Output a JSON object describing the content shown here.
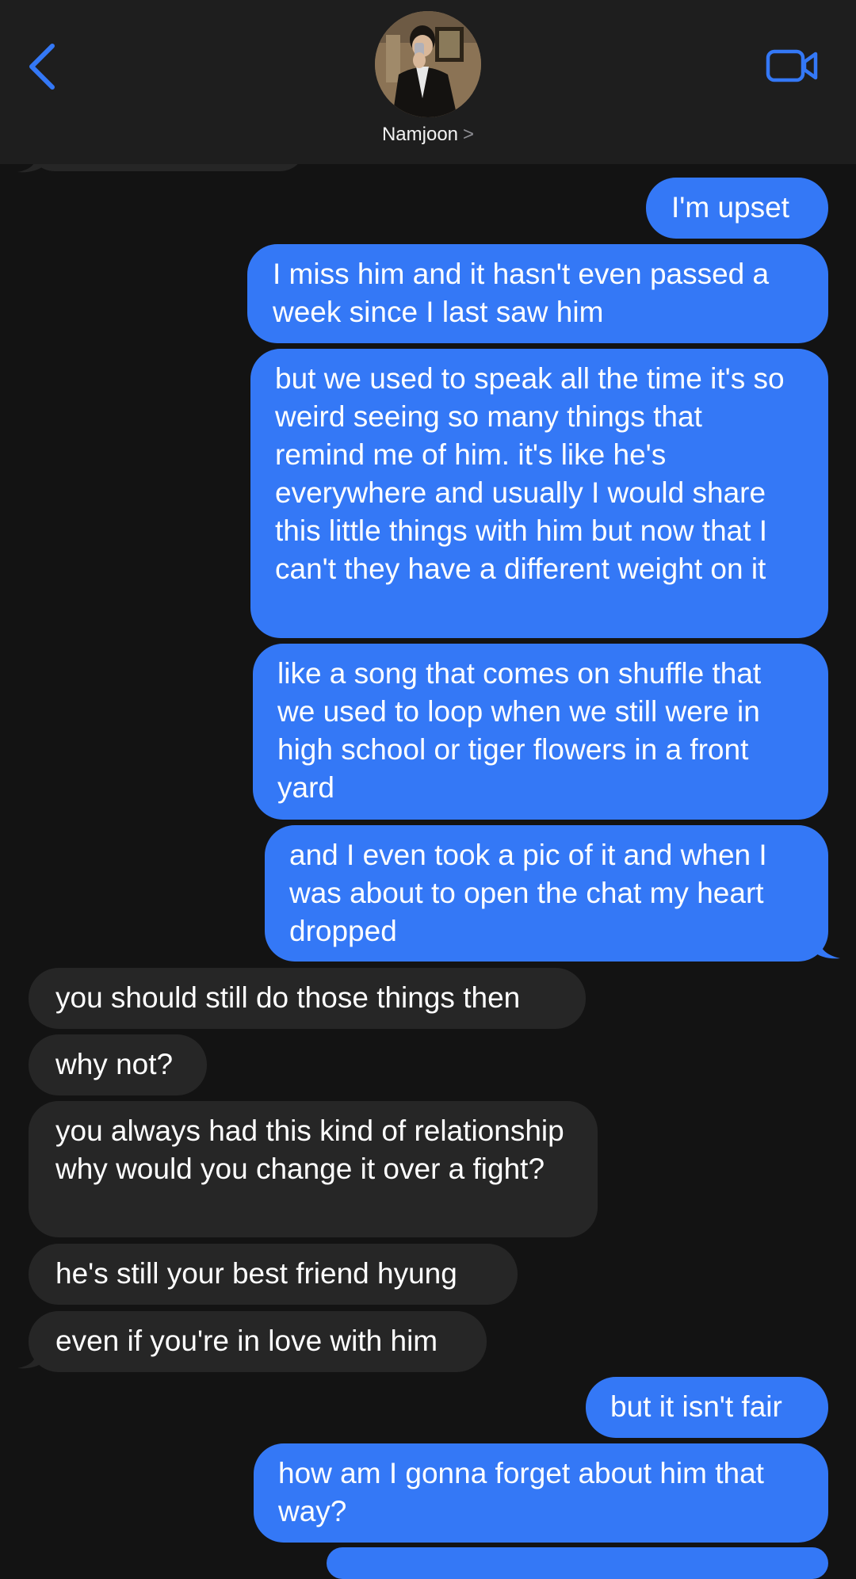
{
  "header": {
    "contact_name": "Namjoon",
    "contact_chevron": ">"
  },
  "icons": {
    "back": "chevron-left-icon",
    "video": "video-camera-icon"
  },
  "colors": {
    "sent_bubble": "#3478f6",
    "received_bubble": "#262626",
    "background": "#131313",
    "header": "#1e1e1e",
    "accent": "#3478f6"
  },
  "messages": [
    {
      "from": "me",
      "text": "I'm upset"
    },
    {
      "from": "me",
      "text": "I miss him and it hasn't even passed a week since I last saw him"
    },
    {
      "from": "me",
      "text": "but we used to speak all the time it's so weird seeing so many things that remind me of him. it's like he's everywhere and usually I would share this little things with him but now that I can't they have a different weight on it"
    },
    {
      "from": "me",
      "text": "like a song that comes on shuffle that we used to loop when we still were in high school or tiger flowers in a front yard"
    },
    {
      "from": "me",
      "text": "and I even took a pic of it and when I was about to open the chat my heart dropped"
    },
    {
      "from": "them",
      "text": "you should still do those things then"
    },
    {
      "from": "them",
      "text": "why not?"
    },
    {
      "from": "them",
      "text": "you always had this kind of relationship why would you change it over a fight?"
    },
    {
      "from": "them",
      "text": "he's still your best friend hyung"
    },
    {
      "from": "them",
      "text": "even if you're in love with him"
    },
    {
      "from": "me",
      "text": "but it isn't fair"
    },
    {
      "from": "me",
      "text": "how am I gonna forget about him that way?"
    }
  ]
}
